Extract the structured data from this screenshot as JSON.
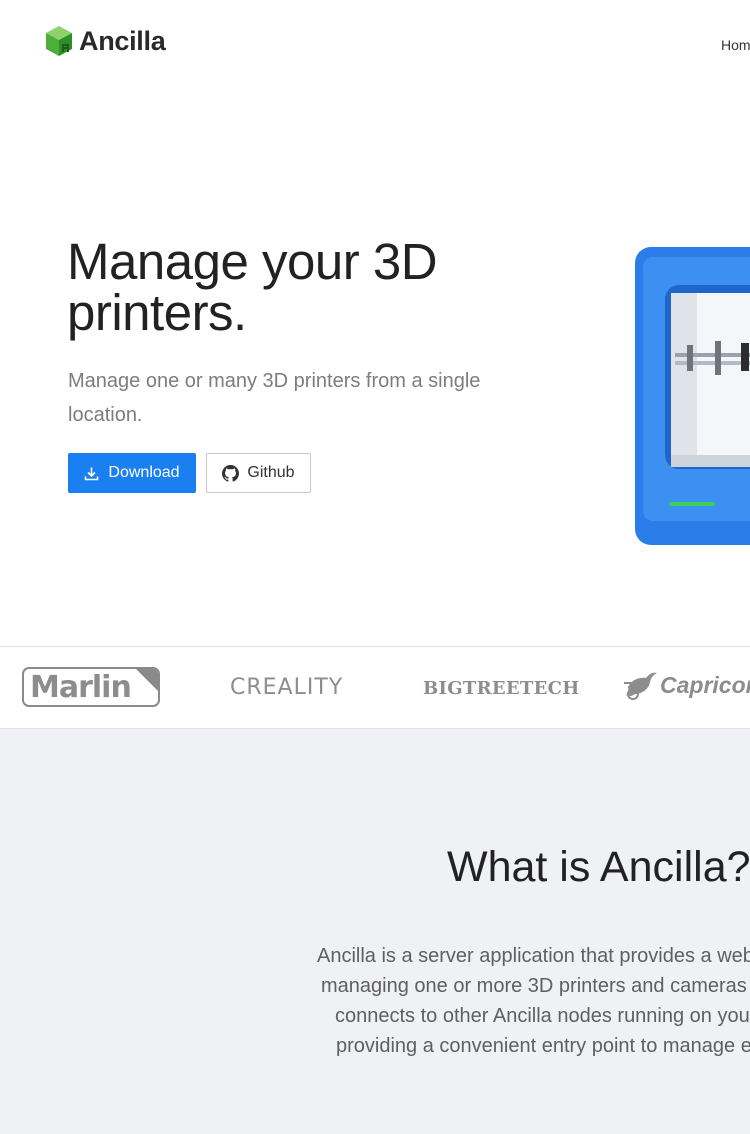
{
  "brand": {
    "name": "Ancilla",
    "logo_icon": "green-cube-icon"
  },
  "nav": {
    "home_label": "Home"
  },
  "hero": {
    "title": "Manage your 3D printers.",
    "subtitle": "Manage one or many 3D printers from a single location.",
    "download_label": "Download",
    "github_label": "Github",
    "accent_color": "#1a7ff0",
    "printer_color": "#2b7de9"
  },
  "partners": {
    "marlin": "Marlin",
    "creality": "CREALITY",
    "bigtreetech": "BIGTREETECH",
    "capricorn": "Capricorn"
  },
  "about": {
    "title": "What is Ancilla?",
    "lines": [
      "Ancilla is a server application that provides a web",
      "managing one or more 3D printers and cameras",
      "connects to other Ancilla nodes running on you",
      "providing a convenient entry point to manage e"
    ]
  }
}
